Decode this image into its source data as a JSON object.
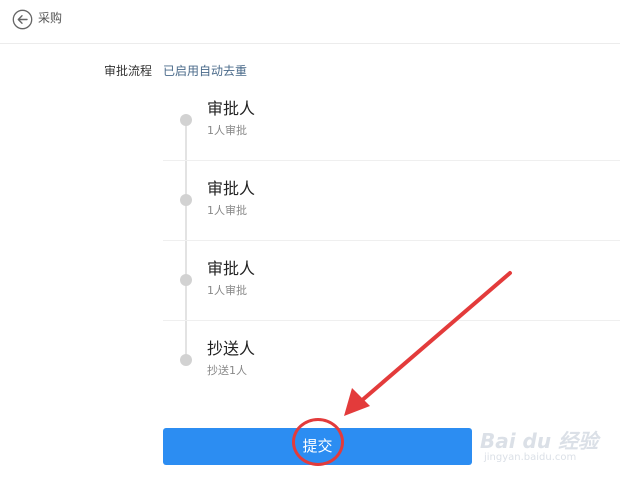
{
  "header": {
    "title": "采购",
    "back_icon": "back-arrow-icon"
  },
  "approval_flow": {
    "label": "审批流程",
    "status": "已启用自动去重"
  },
  "steps": [
    {
      "title": "审批人",
      "subtitle": "1人审批"
    },
    {
      "title": "审批人",
      "subtitle": "1人审批"
    },
    {
      "title": "审批人",
      "subtitle": "1人审批"
    },
    {
      "title": "抄送人",
      "subtitle": "抄送1人"
    }
  ],
  "submit": {
    "label": "提交",
    "color": "#2c8df2"
  },
  "annotation": {
    "color": "#e33b3b"
  },
  "watermark": {
    "main": "Bai du 经验",
    "sub": "jingyan.baidu.com"
  }
}
